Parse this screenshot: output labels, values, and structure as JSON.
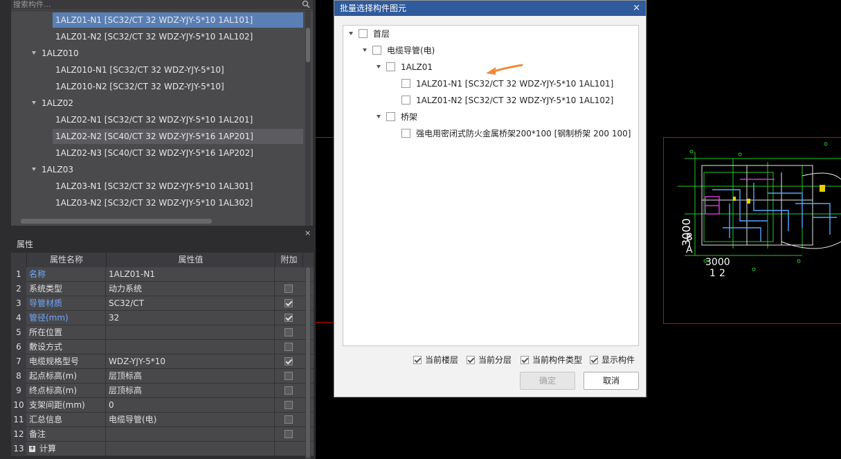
{
  "search": {
    "placeholder": "搜索构件..."
  },
  "tree": {
    "items": [
      {
        "label": "1ALZ01-N1 [SC32/CT 32 WDZ-YJY-5*10 1AL101]",
        "level": 2,
        "state": "selected"
      },
      {
        "label": "1ALZ01-N2 [SC32/CT 32 WDZ-YJY-5*10 1AL102]",
        "level": 2,
        "state": ""
      },
      {
        "label": "1ALZ010",
        "level": 1,
        "state": ""
      },
      {
        "label": "1ALZ010-N1 [SC32/CT 32 WDZ-YJY-5*10]",
        "level": 2,
        "state": ""
      },
      {
        "label": "1ALZ010-N2 [SC32/CT 32 WDZ-YJY-5*10]",
        "level": 2,
        "state": ""
      },
      {
        "label": "1ALZ02",
        "level": 1,
        "state": ""
      },
      {
        "label": "1ALZ02-N1 [SC32/CT 32 WDZ-YJY-5*10 1AL201]",
        "level": 2,
        "state": ""
      },
      {
        "label": "1ALZ02-N2 [SC40/CT 32 WDZ-YJY-5*16 1AP201]",
        "level": 2,
        "state": "hovered"
      },
      {
        "label": "1ALZ02-N3 [SC40/CT 32 WDZ-YJY-5*16 1AP202]",
        "level": 2,
        "state": ""
      },
      {
        "label": "1ALZ03",
        "level": 1,
        "state": ""
      },
      {
        "label": "1ALZ03-N1 [SC32/CT 32 WDZ-YJY-5*10 1AL301]",
        "level": 2,
        "state": ""
      },
      {
        "label": "1ALZ03-N2 [SC32/CT 32 WDZ-YJY-5*10 1AL302]",
        "level": 2,
        "state": ""
      }
    ]
  },
  "properties": {
    "title": "属性",
    "close": "×",
    "headers": {
      "name": "属性名称",
      "value": "属性值",
      "extra": "附加"
    },
    "rows": [
      {
        "idx": "1",
        "name": "名称",
        "value": "1ALZ01-N1",
        "blue": true,
        "check": null
      },
      {
        "idx": "2",
        "name": "系统类型",
        "value": "动力系统",
        "blue": false,
        "check": false
      },
      {
        "idx": "3",
        "name": "导管材质",
        "value": "SC32/CT",
        "blue": true,
        "check": true
      },
      {
        "idx": "4",
        "name": "管径(mm)",
        "value": "32",
        "blue": true,
        "check": true
      },
      {
        "idx": "5",
        "name": "所在位置",
        "value": "",
        "blue": false,
        "check": false
      },
      {
        "idx": "6",
        "name": "敷设方式",
        "value": "",
        "blue": false,
        "check": false
      },
      {
        "idx": "7",
        "name": "电缆规格型号",
        "value": "WDZ-YJY-5*10",
        "blue": false,
        "check": true
      },
      {
        "idx": "8",
        "name": "起点标高(m)",
        "value": "层顶标高",
        "blue": false,
        "check": false
      },
      {
        "idx": "9",
        "name": "终点标高(m)",
        "value": "层顶标高",
        "blue": false,
        "check": false
      },
      {
        "idx": "10",
        "name": "支架间距(mm)",
        "value": "0",
        "blue": false,
        "check": false
      },
      {
        "idx": "11",
        "name": "汇总信息",
        "value": "电缆导管(电)",
        "blue": false,
        "check": false
      },
      {
        "idx": "12",
        "name": "备注",
        "value": "",
        "blue": false,
        "check": false
      },
      {
        "idx": "13",
        "name": "计算",
        "value": "",
        "blue": false,
        "check": null,
        "expand": "+"
      }
    ]
  },
  "dialog": {
    "title": "批量选择构件图元",
    "close": "×",
    "tree": [
      {
        "label": "首层",
        "level": 0,
        "expandable": true
      },
      {
        "label": "电缆导管(电)",
        "level": 1,
        "expandable": true
      },
      {
        "label": "1ALZ01",
        "level": 2,
        "expandable": true
      },
      {
        "label": "1ALZ01-N1 [SC32/CT 32 WDZ-YJY-5*10 1AL101]",
        "level": 3,
        "expandable": false
      },
      {
        "label": "1ALZ01-N2 [SC32/CT 32 WDZ-YJY-5*10 1AL102]",
        "level": 3,
        "expandable": false
      },
      {
        "label": "桥架",
        "level": 2,
        "expandable": true
      },
      {
        "label": "强电用密闭式防火金属桥架200*100 [钢制桥架 200 100]",
        "level": 3,
        "expandable": false
      }
    ],
    "options": [
      "当前楼层",
      "当前分层",
      "当前构件类型",
      "显示构件"
    ],
    "ok": "确定",
    "cancel": "取消",
    "arrow_color": "#f08a3c"
  },
  "cad": {
    "labels": {
      "dim_vertical": "3000",
      "dim_horizontal": "3000",
      "axis_b": "B",
      "axis_a": "A",
      "axis_1": "1",
      "axis_2": "2"
    }
  }
}
